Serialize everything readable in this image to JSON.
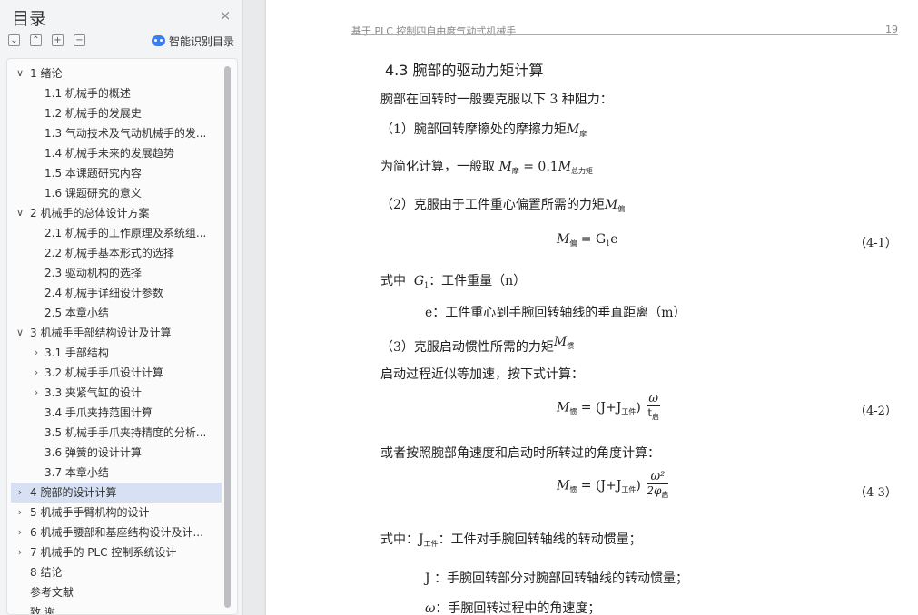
{
  "sidebar": {
    "title": "目录",
    "close_symbol": "×",
    "toolbar": {
      "collapse_all": "⌄",
      "expand_all": "⌃",
      "add": "+",
      "remove": "−"
    },
    "smart_toc_label": "智能识别目录",
    "toc": [
      {
        "label": "1  绪论",
        "level": 0,
        "chevron": "∨"
      },
      {
        "label": "1.1  机械手的概述",
        "level": 1,
        "chevron": ""
      },
      {
        "label": "1.2  机械手的发展史",
        "level": 1,
        "chevron": ""
      },
      {
        "label": "1.3  气动技术及气动机械手的发...",
        "level": 1,
        "chevron": ""
      },
      {
        "label": "1.4  机械手未来的发展趋势",
        "level": 1,
        "chevron": ""
      },
      {
        "label": "1.5  本课题研究内容",
        "level": 1,
        "chevron": ""
      },
      {
        "label": "1.6  课题研究的意义",
        "level": 1,
        "chevron": ""
      },
      {
        "label": "2  机械手的总体设计方案",
        "level": 0,
        "chevron": "∨"
      },
      {
        "label": "2.1  机械手的工作原理及系统组...",
        "level": 1,
        "chevron": ""
      },
      {
        "label": "2.2  机械手基本形式的选择",
        "level": 1,
        "chevron": ""
      },
      {
        "label": "2.3  驱动机构的选择",
        "level": 1,
        "chevron": ""
      },
      {
        "label": "2.4  机械手详细设计参数",
        "level": 1,
        "chevron": ""
      },
      {
        "label": "2.5  本章小结",
        "level": 1,
        "chevron": ""
      },
      {
        "label": "3  机械手手部结构设计及计算",
        "level": 0,
        "chevron": "∨"
      },
      {
        "label": "3.1  手部结构",
        "level": 1,
        "chevron": "›"
      },
      {
        "label": "3.2  机械手手爪设计计算",
        "level": 1,
        "chevron": "›"
      },
      {
        "label": "3.3  夹紧气缸的设计",
        "level": 1,
        "chevron": "›"
      },
      {
        "label": "3.4  手爪夹持范围计算",
        "level": 1,
        "chevron": ""
      },
      {
        "label": "3.5  机械手手爪夹持精度的分析...",
        "level": 1,
        "chevron": ""
      },
      {
        "label": "3.6  弹簧的设计计算",
        "level": 1,
        "chevron": ""
      },
      {
        "label": "3.7  本章小结",
        "level": 1,
        "chevron": ""
      },
      {
        "label": "4  腕部的设计计算",
        "level": 0,
        "chevron": "›",
        "active": true
      },
      {
        "label": "5  机械手手臂机构的设计",
        "level": 0,
        "chevron": "›"
      },
      {
        "label": "6  机械手腰部和基座结构设计及计...",
        "level": 0,
        "chevron": "›"
      },
      {
        "label": "7  机械手的 PLC 控制系统设计",
        "level": 0,
        "chevron": "›"
      },
      {
        "label": "8  结论",
        "level": 0,
        "chevron": ""
      },
      {
        "label": "参考文献",
        "level": -1,
        "chevron": ""
      },
      {
        "label": "致    谢",
        "level": -1,
        "chevron": ""
      }
    ]
  },
  "page": {
    "running_header": "基于 PLC 控制四自由度气动式机械手",
    "page_number": "19",
    "heading_num": "4.3",
    "heading_text": "腕部的驱动力矩计算",
    "p_intro": "腕部在回转时一般要克服以下 3 种阻力：",
    "p1": "（1）腕部回转摩擦处的摩擦力矩",
    "p1_sym": "M",
    "p1_sub": "摩",
    "p_simplify": "为简化计算，一般取",
    "simp_m": "M",
    "simp_sub": "摩",
    "simp_eq": "= 0.1",
    "simp_m2": "M",
    "simp_sub2": "总力矩",
    "p2": "（2）克服由于工件重心偏置所需的力矩",
    "p2_sym": "M",
    "p2_sub": "偏",
    "eq1_m": "M",
    "eq1_sub": "偏",
    "eq1_rhs": " = G",
    "eq1_g_sub": "1",
    "eq1_e": "e",
    "eq1_no": "（4-1）",
    "where1_prefix": "式中",
    "where1_g": "G",
    "where1_g_sub": "1",
    "where1_text": "：工件重量（n）",
    "where2_text": "e：工件重心到手腕回转轴线的垂直距离（m）",
    "p3": "（3）克服启动惯性所需的力矩",
    "p3_sym": "M",
    "p3_sub": "惯",
    "p_startup": "启动过程近似等加速，按下式计算：",
    "eq2_m": "M",
    "eq2_sub": "惯",
    "eq2_mid": " = (J+J",
    "eq2_jsub": "工件",
    "eq2_close": ")",
    "eq2_num": "ω",
    "eq2_den": "t",
    "eq2_den_sub": "启",
    "eq2_no": "（4-2）",
    "p_or": "或者按照腕部角速度和启动时所转过的角度计算：",
    "eq3_m": "M",
    "eq3_sub": "惯",
    "eq3_mid": " = (J+J",
    "eq3_jsub": "工件",
    "eq3_close": ")",
    "eq3_num": "ω²",
    "eq3_den": "2φ",
    "eq3_den_sub": "启",
    "eq3_no": "（4-3）",
    "where3_prefix": "式中：",
    "where3_j": "J",
    "where3_jsub": "工件",
    "where3_text": "：工件对手腕回转轴线的转动惯量；",
    "where4_text": "J ：手腕回转部分对腕部回转轴线的转动惯量；",
    "where5_sym": "ω",
    "where5_text": "：手腕回转过程中的角速度；"
  }
}
